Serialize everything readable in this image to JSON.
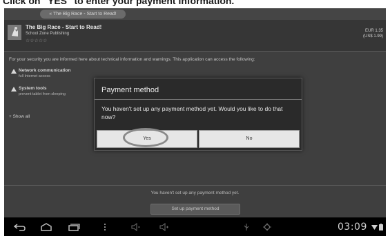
{
  "caption": "Click on \"YES\" to enter your payment information.",
  "topbar": {
    "back_label": "« The Big Race - Start to Read!"
  },
  "app": {
    "title": "The Big Race - Start to Read!",
    "publisher": "School Zone Publishing",
    "stars": "☆☆☆☆☆",
    "price_line1": "EUR 1.35",
    "price_line2": "(US$ 1.99)"
  },
  "security_text": "For your security you are informed here about technical information and warnings. This application can access the following:",
  "permissions": [
    {
      "title": "Network communication",
      "desc": "full Internet access"
    },
    {
      "title": "System tools",
      "desc": "prevent tablet from sleeping"
    }
  ],
  "show_all": "+ Show all",
  "dialog": {
    "title": "Payment method",
    "message": "You haven't set up any payment method yet. Would you like to do that now?",
    "yes_label": "Yes",
    "no_label": "No"
  },
  "footer": {
    "no_payment_text": "You haven't set up any payment method yet.",
    "setup_button": "Set up payment method"
  },
  "navbar": {
    "clock": "03:09",
    "icons": [
      "back-icon",
      "home-icon",
      "recent-apps-icon",
      "menu-icon",
      "volume-down-icon",
      "volume-up-icon",
      "usb-icon",
      "notification-icon",
      "wifi-icon",
      "battery-icon"
    ]
  }
}
